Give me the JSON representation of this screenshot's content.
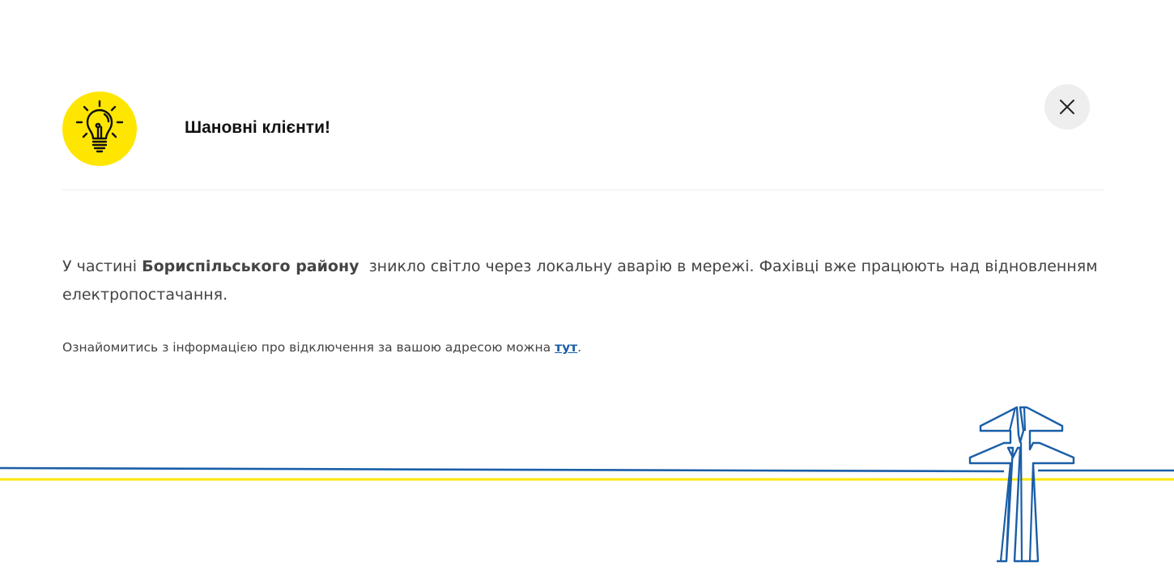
{
  "dialog": {
    "title": "Шановні клієнти!",
    "icon": "lightbulb-icon",
    "close_icon": "close-icon",
    "message": {
      "prefix": "У частині ",
      "highlight": "Бориспільського району",
      "suffix": "  зникло світло через локальну аварію в мережі. Фахівці вже працюють над відновленням електропостачання."
    },
    "info": {
      "text": "Ознайомитись з інформацією про відключення за вашою адресою можна ",
      "link_label": "тут",
      "trailing": "."
    }
  },
  "colors": {
    "accent_yellow": "#ffe600",
    "line_blue": "#1a5ea8",
    "close_bg": "#eeeeee"
  },
  "decoration": {
    "name": "power-line-tower-illustration"
  }
}
